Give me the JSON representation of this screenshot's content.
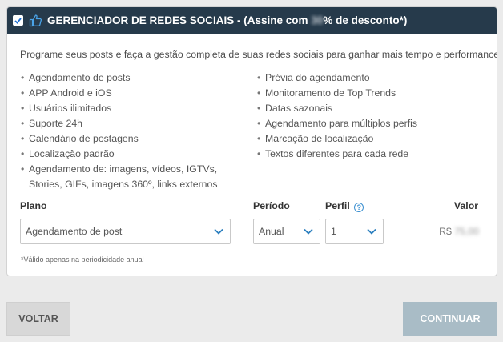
{
  "header": {
    "title_prefix": "GERENCIADOR DE REDES SOCIAIS - (Assine com ",
    "discount_hidden": "30",
    "title_suffix": "% de desconto*)",
    "checked": true
  },
  "intro": "Programe seus posts e faça a gestão completa de suas redes sociais para ganhar mais tempo e performance.",
  "features_left": [
    "Agendamento de posts",
    "APP Android e iOS",
    "Usuários ilimitados",
    "Suporte 24h",
    "Calendário de postagens",
    "Localização padrão",
    "Agendamento de: imagens, vídeos, IGTVs, Stories, GIFs, imagens 360º, links externos"
  ],
  "features_right": [
    "Prévia do agendamento",
    "Monitoramento de Top Trends",
    "Datas sazonais",
    "Agendamento para múltiplos perfis",
    "Marcação de localização",
    "Textos diferentes para cada rede"
  ],
  "fields": {
    "plano_label": "Plano",
    "periodo_label": "Período",
    "perfil_label": "Perfil",
    "valor_label": "Valor",
    "plano_value": "Agendamento de post",
    "periodo_value": "Anual",
    "perfil_value": "1"
  },
  "price": {
    "currency": "R$",
    "amount_hidden": "75,00"
  },
  "note": "*Válido apenas na periodicidade anual",
  "buttons": {
    "back": "VOLTAR",
    "continue": "CONTINUAR"
  },
  "colors": {
    "header_bg": "#263a4b",
    "accent_blue": "#3a8fd0",
    "continue_bg": "#a9bcc6"
  },
  "icons": {
    "checkbox": "checkbox-checked-icon",
    "thumb": "thumbs-up-icon",
    "help": "help-circle-icon",
    "dropdown": "chevron-down-icon"
  }
}
